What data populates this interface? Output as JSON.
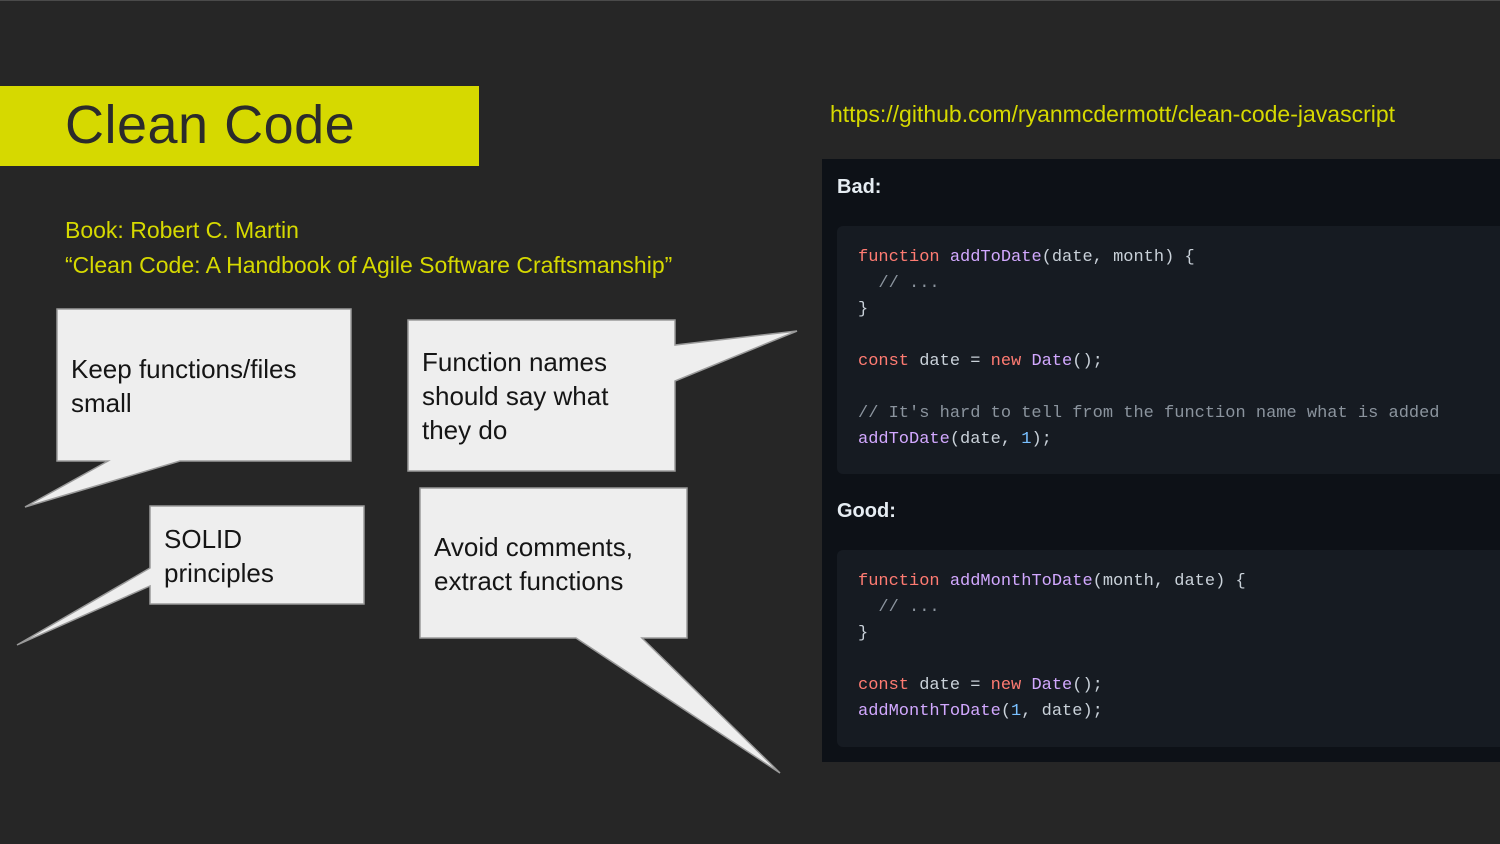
{
  "slide": {
    "title": "Clean Code",
    "book_line1": "Book: Robert C. Martin",
    "book_line2": "“Clean Code: A Handbook of Agile Software Craftsmanship”",
    "link": "https://github.com/ryanmcdermott/clean-code-javascript"
  },
  "bubbles": {
    "b1_line1": "Keep functions/files",
    "b1_line2": "small",
    "b2_line1": "Function names",
    "b2_line2": "should say what",
    "b2_line3": "they do",
    "b3_line1": "SOLID",
    "b3_line2": "principles",
    "b4_line1": "Avoid comments,",
    "b4_line2": "extract functions"
  },
  "code": {
    "bad_label": "Bad:",
    "good_label": "Good:",
    "bad": {
      "kw_function": "function",
      "fn_name": "addToDate",
      "params": "(date, month) {",
      "comment_dots": "  // ...",
      "close": "}",
      "kw_const": "const",
      "var_assign": " date = ",
      "kw_new": "new",
      "ctor": " Date",
      "ctor_end": "();",
      "comment2": "// It's hard to tell from the function name what is added",
      "call_fn": "addToDate",
      "call_open": "(date, ",
      "call_num": "1",
      "call_end": ");"
    },
    "good": {
      "kw_function": "function",
      "fn_name": "addMonthToDate",
      "params": "(month, date) {",
      "comment_dots": "  // ...",
      "close": "}",
      "kw_const": "const",
      "var_assign": " date = ",
      "kw_new": "new",
      "ctor": " Date",
      "ctor_end": "();",
      "call_fn": "addMonthToDate",
      "call_open": "(",
      "call_num": "1",
      "call_end": ", date);"
    }
  },
  "colors": {
    "background": "#262626",
    "accent": "#d6d900",
    "bubble_fill": "#eeeeee",
    "code_bg": "#0d1117",
    "code_box": "#161b22"
  }
}
